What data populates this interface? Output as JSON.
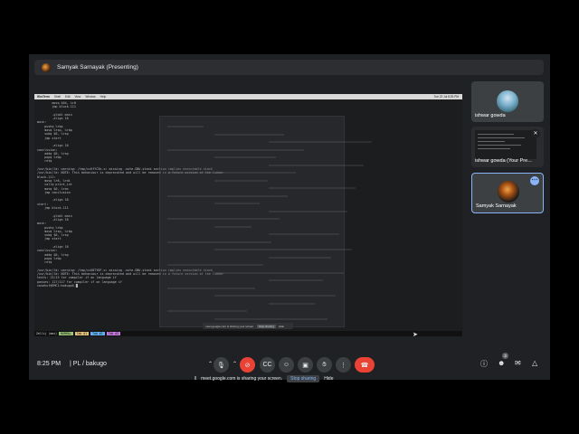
{
  "presenter": {
    "label": "Samyak Sarnayak (Presenting)"
  },
  "shared_screen": {
    "menubar": [
      "WezTerm",
      "Shell",
      "Edit",
      "View",
      "Window",
      "Help"
    ],
    "menubar_right": "Tue 22 Jul 8:25 PM",
    "terminal_lines": [
      "        movq $64, %r8",
      "        jmp block.111",
      "",
      "        .globl main",
      "        .align 16",
      "main:",
      "    pushq %rbp",
      "    movq %rsp, %rbp",
      "    subq $0, %rsp",
      "    jmp start",
      "",
      "        .align 16",
      "conclusion:",
      "    addq $0, %rsp",
      "    popq %rbp",
      "    retq",
      "",
      "/usr/bin/ld: warning: /tmp/ccKfYC5k.o: missing .note.GNU-stack section implies executable stack",
      "/usr/bin/ld: NOTE: This behaviour is deprecated and will be removed in a future version of the linker",
      "block.111:",
      "    movq %r8, %rdi",
      "    callq print_int",
      "    movq $0, %rax",
      "    jmp conclusion",
      "",
      "        .align 16",
      "start:",
      "    jmp block.111",
      "",
      "        .globl main",
      "        .align 16",
      "main:",
      "    pushq %rbp",
      "    movq %rsp, %rbp",
      "    subq $0, %rsp",
      "    jmp start",
      "",
      "        .align 16",
      "conclusion:",
      "    addq $0, %rsp",
      "    popq %rbp",
      "    retq",
      "",
      "/usr/bin/ld: warning: /tmp/ccK8TYDF.o: missing .note.GNU-stack section implies executable stack",
      "/usr/bin/ld: NOTE: This behaviour is deprecated and will be removed in a future version of the linker",
      "tests: 13/13 for compiler if on language if",
      "passes: 117/117 for compiler if on language if",
      "cwsehuf@EMC1:bakugo$ █"
    ],
    "statusline": {
      "app": "Zellij (mex)",
      "mode": "NORMAL",
      "tabs": [
        "Tab #1",
        "Tab #2",
        "Tab #3"
      ]
    },
    "share_banner": {
      "text": "meet.google.com is sharing your screen.",
      "stop_label": "Stop sharing",
      "hide_label": "Hide"
    }
  },
  "participants": [
    {
      "name": "ishwar gowda"
    },
    {
      "name": "ishwar gowda (Your Pre..."
    },
    {
      "name": "Samyak Sarnayak"
    }
  ],
  "bottom_bar": {
    "time": "8:25 PM",
    "separator": "|",
    "meeting_code": "PL / bakugo",
    "people_count": "3"
  },
  "share_notice": {
    "text": "meet.google.com is sharing your screen.",
    "stop_label": "Stop sharing",
    "hide_label": "Hide"
  },
  "colors": {
    "leave": "#ea4335",
    "active_tile_border": "#8ab4f8",
    "meet_background": "#202124"
  },
  "icons": {
    "mic": "microphone-icon",
    "camera": "camera-off-icon",
    "captions": "captions-icon",
    "emoji": "emoji-icon",
    "present": "present-icon",
    "hand": "raise-hand-icon",
    "more": "more-vert-icon",
    "leave": "call-end-icon",
    "info": "info-icon",
    "people": "people-icon",
    "chat": "chat-icon",
    "activities": "activities-icon"
  }
}
